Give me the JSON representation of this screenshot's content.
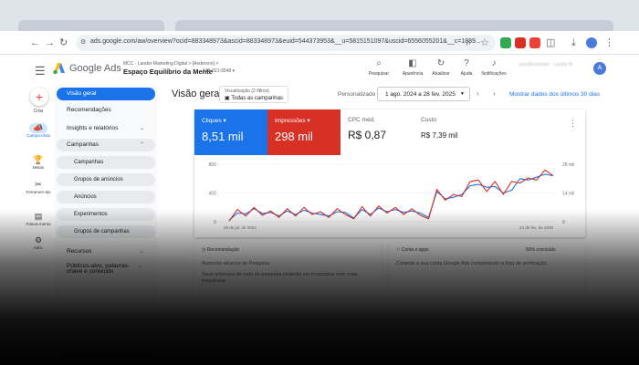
{
  "browser": {
    "url": "ads.google.com/aw/overview?ocid=883348973&ascid=883348973&euid=544373953&__u=5815151097&uscid=6556055201&__c=1889..."
  },
  "header": {
    "brand": "Google Ads",
    "account_mcc": "MCC · Lander Marketing Digital  >  [Anderson]  >",
    "account_name": "Espaço Equilíbrio da Mente",
    "account_id": "618-821-9548",
    "tools": [
      {
        "label": "Pesquisar",
        "icon": "search-icon"
      },
      {
        "label": "Aparência",
        "icon": "appearance-icon"
      },
      {
        "label": "Atualizar",
        "icon": "refresh-icon"
      },
      {
        "label": "Ajuda",
        "icon": "help-icon"
      },
      {
        "label": "Notificações",
        "icon": "bell-icon"
      }
    ],
    "avatar_letter": "A"
  },
  "rail": {
    "create": "Criar",
    "items": [
      {
        "label": "Campa-nhas",
        "icon": "megaphone-icon"
      },
      {
        "label": "Metas",
        "icon": "trophy-icon"
      },
      {
        "label": "Ferramen-tas",
        "icon": "tools-icon"
      },
      {
        "label": "Fatura-mento",
        "icon": "billing-icon"
      },
      {
        "label": "Adm.",
        "icon": "gear-icon"
      }
    ]
  },
  "nav": {
    "overview": "Visão geral",
    "recommendations": "Recomendações",
    "insights": "Insights e relatórios",
    "campaigns_section": "Campanhas",
    "campaigns": "Campanhas",
    "ad_groups": "Grupos de anúncios",
    "ads": "Anúncios",
    "experiments": "Experimentos",
    "campaign_groups": "Grupos de campanhas",
    "assets": "Recursos",
    "audiences": "Públicos-alvo, palavras-chave e conteúdo"
  },
  "main": {
    "title": "Visão geral",
    "view_label": "Visualização (2 filtros)",
    "view_value": "Todas as campanhas",
    "custom_label": "Personalizado",
    "date_range": "1 ago. 2024 a 28 fev. 2025",
    "recent_link": "Mostrar dados dos últimos 30 dias"
  },
  "metrics": [
    {
      "label": "Cliques",
      "value": "8,51 mil"
    },
    {
      "label": "Impressões",
      "value": "298 mil"
    },
    {
      "label": "CPC méd.",
      "value": "R$ 0,87"
    },
    {
      "label": "Custo",
      "value": "R$ 7,39 mil"
    }
  ],
  "colors": {
    "clicks": "#1a73e8",
    "impressions": "#d93025"
  },
  "chart_data": {
    "type": "line",
    "left_axis_ticks": [
      "800",
      "400",
      "0"
    ],
    "right_axis_ticks": [
      "28 mil",
      "14 mil",
      "0"
    ],
    "start_label": "26 de jul. de 2024",
    "end_label": "24 de fev. de 2025",
    "series": [
      {
        "name": "Cliques",
        "axis": "left",
        "values": [
          20,
          120,
          110,
          180,
          115,
          130,
          80,
          150,
          100,
          160,
          120,
          100,
          80,
          140,
          130,
          50,
          170,
          100,
          190,
          140,
          170,
          130,
          150,
          120,
          60,
          420,
          320,
          340,
          380,
          500,
          520,
          480,
          490,
          400,
          440,
          600,
          580,
          620,
          660,
          640
        ]
      },
      {
        "name": "Impressões",
        "axis": "left",
        "values": [
          10,
          170,
          80,
          200,
          90,
          150,
          60,
          180,
          80,
          200,
          100,
          140,
          60,
          180,
          100,
          40,
          210,
          80,
          220,
          120,
          200,
          100,
          180,
          90,
          40,
          450,
          300,
          380,
          350,
          560,
          580,
          420,
          560,
          380,
          560,
          540,
          610,
          580,
          720,
          640
        ]
      }
    ]
  },
  "lower_left": {
    "header": "Recomendação",
    "line1": "Aumente alcance de Pesquisa",
    "line2": "Seus anúncios de rede de pesquisa poderão ser mostrados com mais frequência"
  },
  "lower_right": {
    "header": "Conta e apps",
    "progress": "50% concluído",
    "line1": "Conecte a sua conta Google Ads completando a lista de verificação"
  }
}
